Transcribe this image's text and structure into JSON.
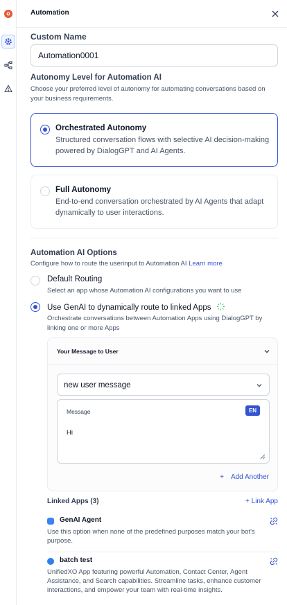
{
  "header": {
    "title": "Automation"
  },
  "custom_name": {
    "label": "Custom Name",
    "value": "Automation0001"
  },
  "autonomy": {
    "title": "Autonomy Level for Automation AI",
    "description": "Choose your preferred level of autonomy for automating conversations based on your business requirements.",
    "options": [
      {
        "title": "Orchestrated Autonomy",
        "description": "Structured conversation flows with selective AI decision-making powered by DialogGPT and AI Agents.",
        "selected": true
      },
      {
        "title": "Full Autonomy",
        "description": "End-to-end conversation orchestrated by AI Agents that adapt dynamically to user interactions.",
        "selected": false
      }
    ]
  },
  "ai_options": {
    "title": "Automation AI Options",
    "description": "Configure how to route the userinput to Automation AI",
    "learn_more": "Learn more",
    "default_routing": {
      "title": "Default Routing",
      "description": "Select an app whose Automation AI configurations you want to use",
      "selected": false
    },
    "genai_routing": {
      "title": "Use GenAI to dynamically route to linked Apps",
      "description": "Orchestrate conversations between Automation Apps using DialogGPT by linking one or more Apps",
      "selected": true
    }
  },
  "message_panel": {
    "title": "Your Message to User",
    "type_select": "new user message",
    "message_label": "Message",
    "language": "EN",
    "message_value": "Hi",
    "add_another": "Add Another"
  },
  "linked_apps": {
    "title": "Linked Apps (3)",
    "link_button": "+ Link App",
    "apps": [
      {
        "name": "GenAI Agent",
        "description": "Use this option when none of the predefined purposes match your bot's purpose.",
        "icon_color": "#3b82f6"
      },
      {
        "name": "batch test",
        "description": "UnifiedXO App featuring powerful Automation, Contact Center, Agent Assistance, and Search capabilities. Streamline tasks, enhance customer interactions, and empower your team with real-time insights.",
        "icon_color": "#2f80ed"
      }
    ]
  },
  "colors": {
    "accent": "#3453d1",
    "logo": "#e8593a"
  }
}
